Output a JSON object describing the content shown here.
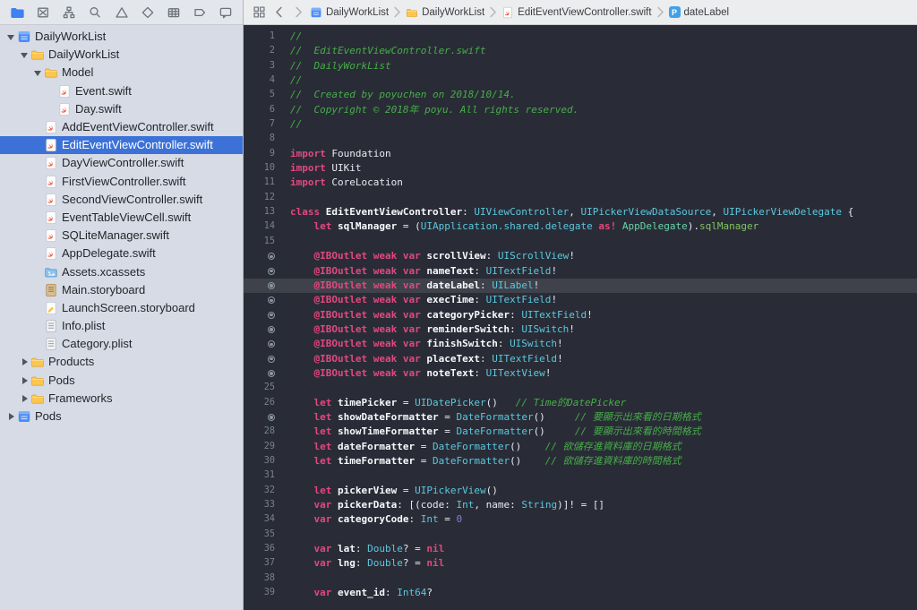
{
  "colors": {
    "selection_blue": "#3c72d8",
    "editor_background": "#292c36",
    "current_line_highlight": "#3f424b",
    "sidebar_background": "#d6dbe5",
    "syntax_keyword": "#e2487f",
    "syntax_type": "#5bc8e0",
    "syntax_comment": "#47ad49",
    "syntax_number": "#837ed1",
    "syntax_project_type": "#69d3ac",
    "syntax_project_property": "#85c266",
    "syntax_plain": "#e8eaf2",
    "active_navigator_tab": "#3f80f2"
  },
  "navigator_bar": {
    "icons": [
      {
        "name": "project-navigator",
        "active": true
      },
      {
        "name": "source-control-navigator",
        "active": false
      },
      {
        "name": "symbol-navigator",
        "active": false
      },
      {
        "name": "find-navigator",
        "active": false
      },
      {
        "name": "issue-navigator",
        "active": false
      },
      {
        "name": "test-navigator",
        "active": false
      },
      {
        "name": "debug-navigator",
        "active": false
      },
      {
        "name": "breakpoint-navigator",
        "active": false
      },
      {
        "name": "report-navigator",
        "active": false
      }
    ]
  },
  "jump_bar": {
    "items": [
      {
        "icon": "project",
        "label": "DailyWorkList"
      },
      {
        "icon": "folder",
        "label": "DailyWorkList"
      },
      {
        "icon": "swift",
        "label": "EditEventViewController.swift"
      },
      {
        "icon": "property-badge",
        "label": "dateLabel"
      }
    ],
    "property_badge_letter": "P"
  },
  "sidebar": {
    "items": [
      {
        "level": 0,
        "disclosure": "open",
        "icon": "project",
        "label": "DailyWorkList",
        "selected": false
      },
      {
        "level": 1,
        "disclosure": "open",
        "icon": "folder",
        "label": "DailyWorkList",
        "selected": false
      },
      {
        "level": 2,
        "disclosure": "open",
        "icon": "folder",
        "label": "Model",
        "selected": false
      },
      {
        "level": 3,
        "disclosure": "none",
        "icon": "swift",
        "label": "Event.swift",
        "selected": false
      },
      {
        "level": 3,
        "disclosure": "none",
        "icon": "swift",
        "label": "Day.swift",
        "selected": false
      },
      {
        "level": 2,
        "disclosure": "none",
        "icon": "swift",
        "label": "AddEventViewController.swift",
        "selected": false
      },
      {
        "level": 2,
        "disclosure": "none",
        "icon": "swift",
        "label": "EditEventViewController.swift",
        "selected": true
      },
      {
        "level": 2,
        "disclosure": "none",
        "icon": "swift",
        "label": "DayViewController.swift",
        "selected": false
      },
      {
        "level": 2,
        "disclosure": "none",
        "icon": "swift",
        "label": "FirstViewController.swift",
        "selected": false
      },
      {
        "level": 2,
        "disclosure": "none",
        "icon": "swift",
        "label": "SecondViewController.swift",
        "selected": false
      },
      {
        "level": 2,
        "disclosure": "none",
        "icon": "swift",
        "label": "EventTableViewCell.swift",
        "selected": false
      },
      {
        "level": 2,
        "disclosure": "none",
        "icon": "swift",
        "label": "SQLiteManager.swift",
        "selected": false
      },
      {
        "level": 2,
        "disclosure": "none",
        "icon": "swift",
        "label": "AppDelegate.swift",
        "selected": false
      },
      {
        "level": 2,
        "disclosure": "none",
        "icon": "assets",
        "label": "Assets.xcassets",
        "selected": false
      },
      {
        "level": 2,
        "disclosure": "none",
        "icon": "storyboard",
        "label": "Main.storyboard",
        "selected": false
      },
      {
        "level": 2,
        "disclosure": "none",
        "icon": "storyboard2",
        "label": "LaunchScreen.storyboard",
        "selected": false
      },
      {
        "level": 2,
        "disclosure": "none",
        "icon": "plist",
        "label": "Info.plist",
        "selected": false
      },
      {
        "level": 2,
        "disclosure": "none",
        "icon": "plist",
        "label": "Category.plist",
        "selected": false
      },
      {
        "level": 1,
        "disclosure": "closed",
        "icon": "folder",
        "label": "Products",
        "selected": false
      },
      {
        "level": 1,
        "disclosure": "closed",
        "icon": "folder",
        "label": "Pods",
        "selected": false
      },
      {
        "level": 1,
        "disclosure": "closed",
        "icon": "folder",
        "label": "Frameworks",
        "selected": false
      },
      {
        "level": 0,
        "disclosure": "closed",
        "icon": "project",
        "label": "Pods",
        "selected": false
      }
    ]
  },
  "editor": {
    "lines": [
      {
        "n": "1",
        "g": "num",
        "hl": false,
        "t": [
          [
            "cm",
            "//"
          ]
        ]
      },
      {
        "n": "2",
        "g": "num",
        "hl": false,
        "t": [
          [
            "cm",
            "//  EditEventViewController.swift"
          ]
        ]
      },
      {
        "n": "3",
        "g": "num",
        "hl": false,
        "t": [
          [
            "cm",
            "//  DailyWorkList"
          ]
        ]
      },
      {
        "n": "4",
        "g": "num",
        "hl": false,
        "t": [
          [
            "cm",
            "//"
          ]
        ]
      },
      {
        "n": "5",
        "g": "num",
        "hl": false,
        "t": [
          [
            "cm",
            "//  Created by poyuchen on 2018/10/14."
          ]
        ]
      },
      {
        "n": "6",
        "g": "num",
        "hl": false,
        "t": [
          [
            "cm",
            "//  Copyright © 2018年 poyu. All rights reserved."
          ]
        ]
      },
      {
        "n": "7",
        "g": "num",
        "hl": false,
        "t": [
          [
            "cm",
            "//"
          ]
        ]
      },
      {
        "n": "8",
        "g": "num",
        "hl": false,
        "t": []
      },
      {
        "n": "9",
        "g": "num",
        "hl": false,
        "t": [
          [
            "kw",
            "import"
          ],
          [
            "pl",
            " Foundation"
          ]
        ]
      },
      {
        "n": "10",
        "g": "num",
        "hl": false,
        "t": [
          [
            "kw",
            "import"
          ],
          [
            "pl",
            " UIKit"
          ]
        ]
      },
      {
        "n": "11",
        "g": "num",
        "hl": false,
        "t": [
          [
            "kw",
            "import"
          ],
          [
            "pl",
            " CoreLocation"
          ]
        ]
      },
      {
        "n": "12",
        "g": "num",
        "hl": false,
        "t": []
      },
      {
        "n": "13",
        "g": "num",
        "hl": false,
        "t": [
          [
            "kw",
            "class"
          ],
          [
            "nm",
            " EditEventViewController"
          ],
          [
            "pl",
            ": "
          ],
          [
            "ty",
            "UIViewController"
          ],
          [
            "pl",
            ", "
          ],
          [
            "ty",
            "UIPickerViewDataSource"
          ],
          [
            "pl",
            ", "
          ],
          [
            "ty",
            "UIPickerViewDelegate"
          ],
          [
            "pl",
            " {"
          ]
        ]
      },
      {
        "n": "14",
        "g": "num",
        "hl": false,
        "t": [
          [
            "pl",
            "    "
          ],
          [
            "kw",
            "let"
          ],
          [
            "nm",
            " sqlManager"
          ],
          [
            "pl",
            " = ("
          ],
          [
            "ty",
            "UIApplication.shared.delegate"
          ],
          [
            "kw",
            " as!"
          ],
          [
            "pl",
            " "
          ],
          [
            "pj",
            "AppDelegate"
          ],
          [
            "pl",
            ")."
          ],
          [
            "pr",
            "sqlManager"
          ]
        ]
      },
      {
        "n": "15",
        "g": "num",
        "hl": false,
        "t": []
      },
      {
        "n": "16",
        "g": "outlet",
        "hl": false,
        "t": [
          [
            "pl",
            "    "
          ],
          [
            "kw",
            "@IBOutlet weak var"
          ],
          [
            "nm",
            " scrollView"
          ],
          [
            "pl",
            ": "
          ],
          [
            "ty",
            "UIScrollView"
          ],
          [
            "pl",
            "!"
          ]
        ]
      },
      {
        "n": "17",
        "g": "outlet",
        "hl": false,
        "t": [
          [
            "pl",
            "    "
          ],
          [
            "kw",
            "@IBOutlet weak var"
          ],
          [
            "nm",
            " nameText"
          ],
          [
            "pl",
            ": "
          ],
          [
            "ty",
            "UITextField"
          ],
          [
            "pl",
            "!"
          ]
        ]
      },
      {
        "n": "18",
        "g": "outlet",
        "hl": true,
        "t": [
          [
            "pl",
            "    "
          ],
          [
            "kw",
            "@IBOutlet weak var"
          ],
          [
            "nm",
            " dateLabel"
          ],
          [
            "pl",
            ": "
          ],
          [
            "ty",
            "UILabel"
          ],
          [
            "pl",
            "!"
          ]
        ]
      },
      {
        "n": "19",
        "g": "outlet",
        "hl": false,
        "t": [
          [
            "pl",
            "    "
          ],
          [
            "kw",
            "@IBOutlet weak var"
          ],
          [
            "nm",
            " execTime"
          ],
          [
            "pl",
            ": "
          ],
          [
            "ty",
            "UITextField"
          ],
          [
            "pl",
            "!"
          ]
        ]
      },
      {
        "n": "20",
        "g": "outlet",
        "hl": false,
        "t": [
          [
            "pl",
            "    "
          ],
          [
            "kw",
            "@IBOutlet weak var"
          ],
          [
            "nm",
            " categoryPicker"
          ],
          [
            "pl",
            ": "
          ],
          [
            "ty",
            "UITextField"
          ],
          [
            "pl",
            "!"
          ]
        ]
      },
      {
        "n": "21",
        "g": "outlet",
        "hl": false,
        "t": [
          [
            "pl",
            "    "
          ],
          [
            "kw",
            "@IBOutlet weak var"
          ],
          [
            "nm",
            " reminderSwitch"
          ],
          [
            "pl",
            ": "
          ],
          [
            "ty",
            "UISwitch"
          ],
          [
            "pl",
            "!"
          ]
        ]
      },
      {
        "n": "22",
        "g": "outlet",
        "hl": false,
        "t": [
          [
            "pl",
            "    "
          ],
          [
            "kw",
            "@IBOutlet weak var"
          ],
          [
            "nm",
            " finishSwitch"
          ],
          [
            "pl",
            ": "
          ],
          [
            "ty",
            "UISwitch"
          ],
          [
            "pl",
            "!"
          ]
        ]
      },
      {
        "n": "23",
        "g": "outlet",
        "hl": false,
        "t": [
          [
            "pl",
            "    "
          ],
          [
            "kw",
            "@IBOutlet weak var"
          ],
          [
            "nm",
            " placeText"
          ],
          [
            "pl",
            ": "
          ],
          [
            "ty",
            "UITextField"
          ],
          [
            "pl",
            "!"
          ]
        ]
      },
      {
        "n": "24",
        "g": "outlet",
        "hl": false,
        "t": [
          [
            "pl",
            "    "
          ],
          [
            "kw",
            "@IBOutlet weak var"
          ],
          [
            "nm",
            " noteText"
          ],
          [
            "pl",
            ": "
          ],
          [
            "ty",
            "UITextView"
          ],
          [
            "pl",
            "!"
          ]
        ]
      },
      {
        "n": "25",
        "g": "num",
        "hl": false,
        "t": []
      },
      {
        "n": "26",
        "g": "num",
        "hl": false,
        "t": [
          [
            "pl",
            "    "
          ],
          [
            "kw",
            "let"
          ],
          [
            "nm",
            " timePicker"
          ],
          [
            "pl",
            " = "
          ],
          [
            "ty",
            "UIDatePicker"
          ],
          [
            "pl",
            "()"
          ],
          [
            "cm",
            "   // Time的DatePicker"
          ]
        ]
      },
      {
        "n": "27",
        "g": "outlet",
        "hl": false,
        "t": [
          [
            "pl",
            "    "
          ],
          [
            "kw",
            "let"
          ],
          [
            "nm",
            " showDateFormatter"
          ],
          [
            "pl",
            " = "
          ],
          [
            "ty",
            "DateFormatter"
          ],
          [
            "pl",
            "()"
          ],
          [
            "cm",
            "     // 要顯示出來看的日期格式"
          ]
        ]
      },
      {
        "n": "28",
        "g": "num",
        "hl": false,
        "t": [
          [
            "pl",
            "    "
          ],
          [
            "kw",
            "let"
          ],
          [
            "nm",
            " showTimeFormatter"
          ],
          [
            "pl",
            " = "
          ],
          [
            "ty",
            "DateFormatter"
          ],
          [
            "pl",
            "()"
          ],
          [
            "cm",
            "     // 要顯示出來看的時間格式"
          ]
        ]
      },
      {
        "n": "29",
        "g": "num",
        "hl": false,
        "t": [
          [
            "pl",
            "    "
          ],
          [
            "kw",
            "let"
          ],
          [
            "nm",
            " dateFormatter"
          ],
          [
            "pl",
            " = "
          ],
          [
            "ty",
            "DateFormatter"
          ],
          [
            "pl",
            "()"
          ],
          [
            "cm",
            "    // 欲儲存進資料庫的日期格式"
          ]
        ]
      },
      {
        "n": "30",
        "g": "num",
        "hl": false,
        "t": [
          [
            "pl",
            "    "
          ],
          [
            "kw",
            "let"
          ],
          [
            "nm",
            " timeFormatter"
          ],
          [
            "pl",
            " = "
          ],
          [
            "ty",
            "DateFormatter"
          ],
          [
            "pl",
            "()"
          ],
          [
            "cm",
            "    // 欲儲存進資料庫的時間格式"
          ]
        ]
      },
      {
        "n": "31",
        "g": "num",
        "hl": false,
        "t": []
      },
      {
        "n": "32",
        "g": "num",
        "hl": false,
        "t": [
          [
            "pl",
            "    "
          ],
          [
            "kw",
            "let"
          ],
          [
            "nm",
            " pickerView"
          ],
          [
            "pl",
            " = "
          ],
          [
            "ty",
            "UIPickerView"
          ],
          [
            "pl",
            "()"
          ]
        ]
      },
      {
        "n": "33",
        "g": "num",
        "hl": false,
        "t": [
          [
            "pl",
            "    "
          ],
          [
            "kw",
            "var"
          ],
          [
            "nm",
            " pickerData"
          ],
          [
            "pl",
            ": [(code: "
          ],
          [
            "ty",
            "Int"
          ],
          [
            "pl",
            ", name: "
          ],
          [
            "ty",
            "String"
          ],
          [
            "pl",
            ")]! = []"
          ]
        ]
      },
      {
        "n": "34",
        "g": "num",
        "hl": false,
        "t": [
          [
            "pl",
            "    "
          ],
          [
            "kw",
            "var"
          ],
          [
            "nm",
            " categoryCode"
          ],
          [
            "pl",
            ": "
          ],
          [
            "ty",
            "Int"
          ],
          [
            "pl",
            " = "
          ],
          [
            "nu",
            "0"
          ]
        ]
      },
      {
        "n": "35",
        "g": "num",
        "hl": false,
        "t": []
      },
      {
        "n": "36",
        "g": "num",
        "hl": false,
        "t": [
          [
            "pl",
            "    "
          ],
          [
            "kw",
            "var"
          ],
          [
            "nm",
            " lat"
          ],
          [
            "pl",
            ": "
          ],
          [
            "ty",
            "Double"
          ],
          [
            "pl",
            "? = "
          ],
          [
            "kw",
            "nil"
          ]
        ]
      },
      {
        "n": "37",
        "g": "num",
        "hl": false,
        "t": [
          [
            "pl",
            "    "
          ],
          [
            "kw",
            "var"
          ],
          [
            "nm",
            " lng"
          ],
          [
            "pl",
            ": "
          ],
          [
            "ty",
            "Double"
          ],
          [
            "pl",
            "? = "
          ],
          [
            "kw",
            "nil"
          ]
        ]
      },
      {
        "n": "38",
        "g": "num",
        "hl": false,
        "t": []
      },
      {
        "n": "39",
        "g": "num",
        "hl": false,
        "t": [
          [
            "pl",
            "    "
          ],
          [
            "kw",
            "var"
          ],
          [
            "nm",
            " event_id"
          ],
          [
            "pl",
            ": "
          ],
          [
            "ty",
            "Int64"
          ],
          [
            "pl",
            "?"
          ]
        ]
      }
    ]
  }
}
